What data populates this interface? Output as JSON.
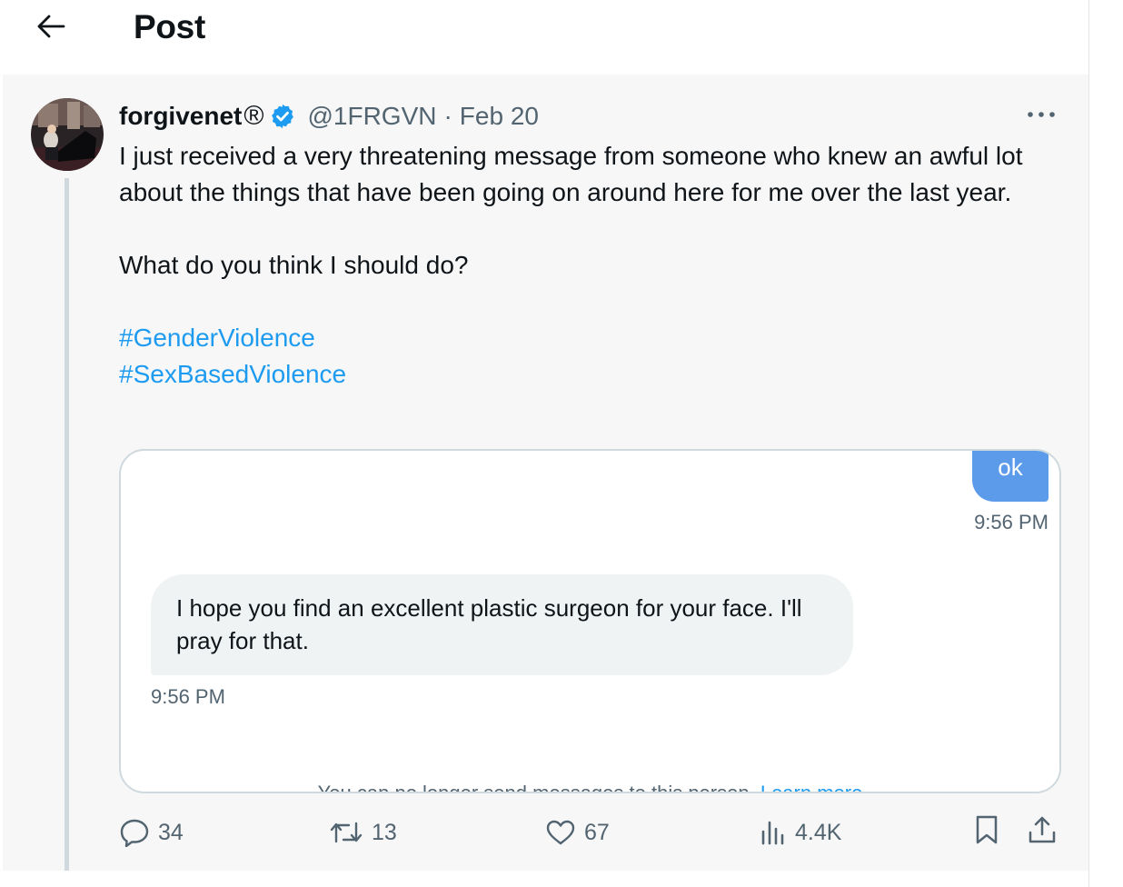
{
  "header": {
    "title": "Post",
    "back_icon": "arrow-left-icon"
  },
  "post": {
    "author": {
      "display_name": "forgivenet",
      "name_suffix": "®",
      "verified_icon": "verified-badge-icon",
      "handle": "@1FRGVN",
      "separator": "·",
      "date": "Feb 20",
      "avatar_description": "avatar-icon"
    },
    "more_icon": "more-dots-icon",
    "text_paragraph_1": "I just received a very threatening message from someone who knew an awful lot about the things that have been going on around here for me over the last year.",
    "text_paragraph_2": "What do you think I should do?",
    "hashtags": [
      "#GenderViolence",
      "#SexBasedViolence"
    ],
    "embedded_image": {
      "outgoing_message": "ok",
      "outgoing_time": "9:56 PM",
      "incoming_message": "I hope you find an excellent plastic surgeon for your face. I'll pray for that.",
      "incoming_time": "9:56 PM",
      "cutoff_text": "You can no longer send messages to this person.",
      "cutoff_link": "Learn more"
    },
    "actions": {
      "replies": "34",
      "reposts": "13",
      "likes": "67",
      "views": "4.4K"
    }
  },
  "colors": {
    "accent": "#1d9bf0",
    "outgoing_bubble": "#5b9bea",
    "incoming_bubble": "#eff3f4",
    "secondary_text": "#536471"
  }
}
